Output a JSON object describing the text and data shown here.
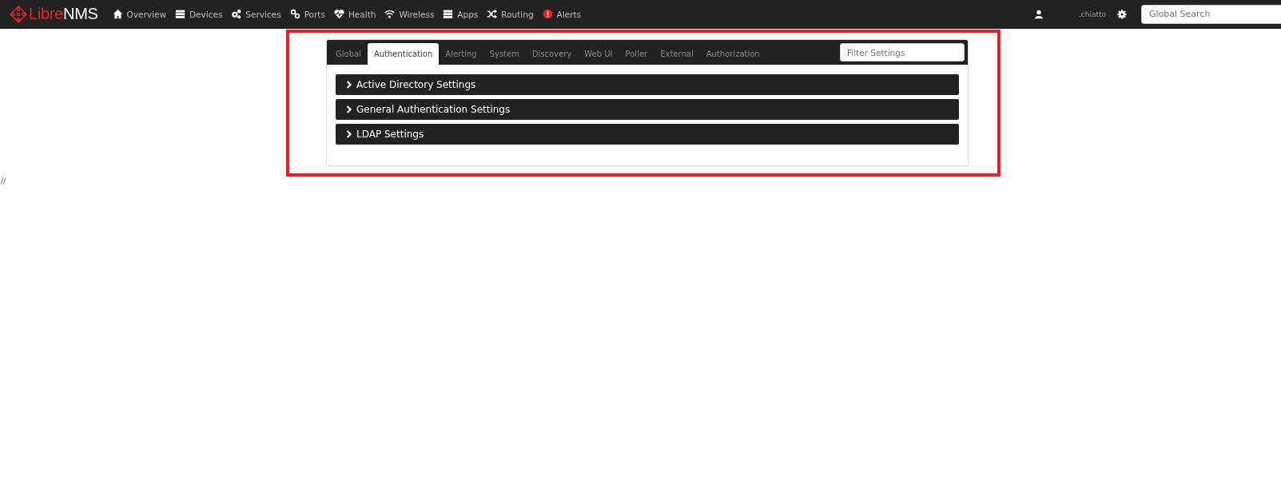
{
  "navbar": {
    "brand": {
      "part1": "Libre",
      "part2": "NMS"
    },
    "items": [
      {
        "label": "Overview"
      },
      {
        "label": "Devices"
      },
      {
        "label": "Services"
      },
      {
        "label": "Ports"
      },
      {
        "label": "Health"
      },
      {
        "label": "Wireless"
      },
      {
        "label": "Apps"
      },
      {
        "label": "Routing"
      },
      {
        "label": "Alerts"
      }
    ],
    "user": ".chiatto",
    "search": {
      "placeholder": "Global Search"
    }
  },
  "settings": {
    "tabs": [
      {
        "label": "Global",
        "selected": false
      },
      {
        "label": "Authentication",
        "selected": true
      },
      {
        "label": "Alerting",
        "selected": false
      },
      {
        "label": "System",
        "selected": false
      },
      {
        "label": "Discovery",
        "selected": false
      },
      {
        "label": "Web UI",
        "selected": false
      },
      {
        "label": "Poller",
        "selected": false
      },
      {
        "label": "External",
        "selected": false
      },
      {
        "label": "Authorization",
        "selected": false
      }
    ],
    "filter": {
      "placeholder": "Filter Settings"
    },
    "panels": [
      {
        "title": "Active Directory Settings",
        "expanded": false
      },
      {
        "title": "General Authentication Settings",
        "expanded": false
      },
      {
        "title": "LDAP Settings",
        "expanded": false
      }
    ]
  },
  "footer_text": "//"
}
